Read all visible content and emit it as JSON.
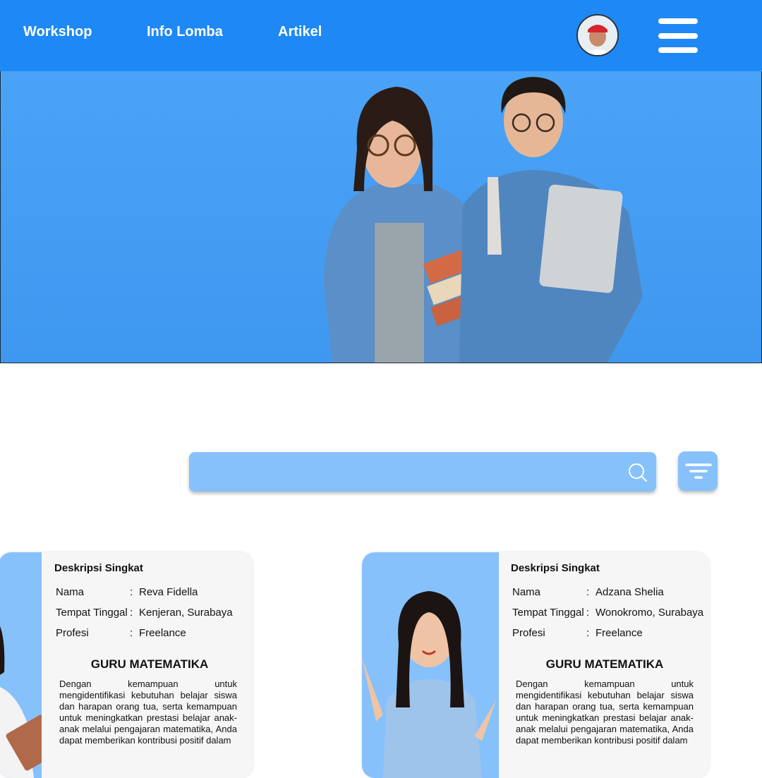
{
  "nav": {
    "links": [
      "Workshop",
      "Info Lomba",
      "Artikel"
    ],
    "avatar_icon": "user-avatar",
    "menu_icon": "hamburger-menu-icon"
  },
  "colors": {
    "primary": "#1e88f5",
    "hero_bg": "#4aa3f7",
    "card_accent": "#86c1fb",
    "card_bg": "#f6f6f6"
  },
  "search": {
    "value": "",
    "placeholder": "",
    "icon": "search-icon",
    "filter_icon": "filter-icon"
  },
  "cards": [
    {
      "heading": "Deskripsi Singkat",
      "fields": [
        {
          "label": "Nama",
          "value": "Reva Fidella"
        },
        {
          "label": "Tempat Tinggal",
          "value": "Kenjeran, Surabaya"
        },
        {
          "label": "Profesi",
          "value": "Freelance"
        }
      ],
      "role": "GURU MATEMATIKA",
      "description": "Dengan kemampuan untuk mengidentifikasi kebutuhan belajar siswa dan harapan orang tua, serta kemampuan untuk meningkatkan prestasi belajar anak-anak melalui pengajaran matematika, Anda dapat memberikan kontribusi positif dalam"
    },
    {
      "heading": "Deskripsi Singkat",
      "fields": [
        {
          "label": "Nama",
          "value": "Adzana Shelia"
        },
        {
          "label": "Tempat Tinggal",
          "value": "Wonokromo, Surabaya"
        },
        {
          "label": "Profesi",
          "value": "Freelance"
        }
      ],
      "role": "GURU MATEMATIKA",
      "description": "Dengan kemampuan untuk mengidentifikasi kebutuhan belajar siswa dan harapan orang tua, serta kemampuan untuk meningkatkan prestasi belajar anak-anak melalui pengajaran matematika, Anda dapat memberikan kontribusi positif dalam"
    }
  ]
}
